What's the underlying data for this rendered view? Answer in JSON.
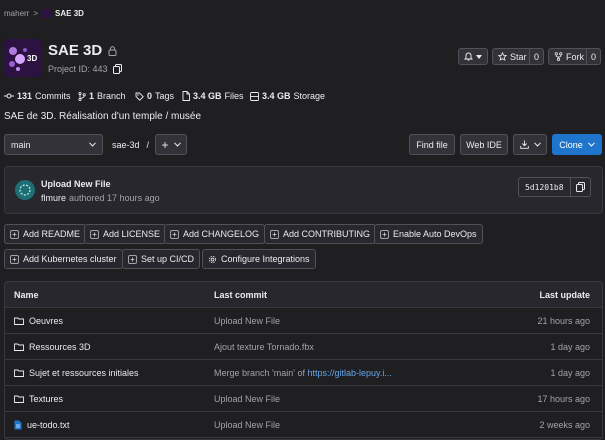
{
  "breadcrumb": {
    "user": "maherr",
    "separator": ">",
    "project": "SAE 3D"
  },
  "project": {
    "name": "SAE 3D",
    "avatar_label": "3D",
    "project_id_label": "Project ID: 443",
    "description": "SAE de 3D. Réalisation d'un temple / musée"
  },
  "header_actions": {
    "notify_icon": "bell-icon",
    "star_label": "Star",
    "star_count": "0",
    "fork_label": "Fork",
    "fork_count": "0"
  },
  "stats": [
    {
      "icon": "commit-icon",
      "value": "131",
      "label": "Commits"
    },
    {
      "icon": "branch-icon",
      "value": "1",
      "label": "Branch"
    },
    {
      "icon": "tag-icon",
      "value": "0",
      "label": "Tags"
    },
    {
      "icon": "file-icon",
      "value": "3.4 GB",
      "label": "Files"
    },
    {
      "icon": "storage-icon",
      "value": "3.4 GB",
      "label": "Storage"
    }
  ],
  "toolbar": {
    "branch": "main",
    "path": "sae-3d",
    "path_sep": "/",
    "add_label": "+",
    "find_file": "Find file",
    "web_ide": "Web IDE",
    "clone": "Clone"
  },
  "commit": {
    "message": "Upload New File",
    "author": "flmure",
    "time": "authored 17 hours ago",
    "sha": "5d1201b8"
  },
  "quick_actions": [
    "Add README",
    "Add LICENSE",
    "Add CHANGELOG",
    "Add CONTRIBUTING",
    "Enable Auto DevOps",
    "Add Kubernetes cluster",
    "Set up CI/CD",
    "Configure Integrations"
  ],
  "table": {
    "headers": {
      "name": "Name",
      "commit": "Last commit",
      "update": "Last update"
    },
    "rows": [
      {
        "type": "folder",
        "name": "Oeuvres",
        "commit": "Upload New File",
        "link": "",
        "update": "21 hours ago"
      },
      {
        "type": "folder",
        "name": "Ressources 3D",
        "commit": "Ajout texture Tornado.fbx",
        "link": "",
        "update": "1 day ago"
      },
      {
        "type": "folder",
        "name": "Sujet et ressources initiales",
        "commit": "Merge branch 'main' of ",
        "link": "https://gitlab-lepuy.i...",
        "update": "1 day ago"
      },
      {
        "type": "folder",
        "name": "Textures",
        "commit": "Upload New File",
        "link": "",
        "update": "17 hours ago"
      },
      {
        "type": "file",
        "name": "ue-todo.txt",
        "commit": "Upload New File",
        "link": "",
        "update": "2 weeks ago"
      }
    ]
  },
  "colors": {
    "bg": "#1f1f22",
    "accent": "#1f75cb",
    "link": "#63a6e9",
    "avatar": "#2b1240"
  }
}
